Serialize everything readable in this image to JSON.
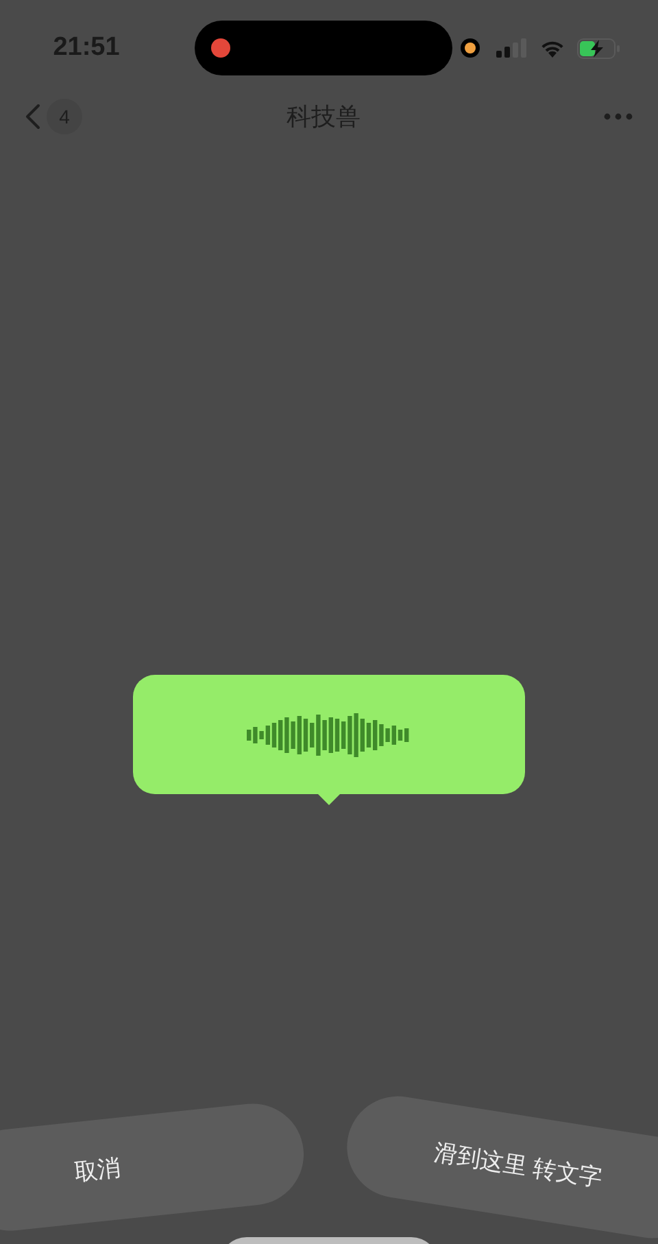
{
  "status_bar": {
    "time": "21:51"
  },
  "nav": {
    "back_count": "4",
    "title": "科技兽"
  },
  "voice_bubble": {
    "kind": "recording"
  },
  "actions": [
    {
      "label": "取消"
    },
    {
      "label": "滑到这里 转文字"
    }
  ]
}
